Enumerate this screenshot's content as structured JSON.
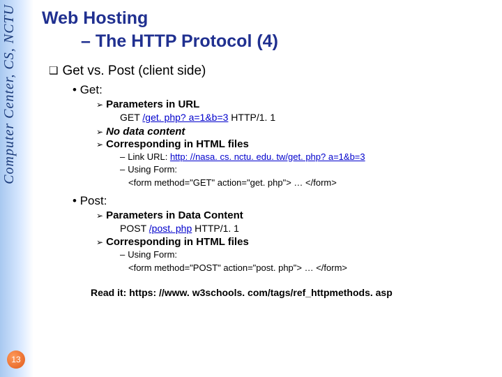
{
  "sidebar": {
    "label": "Computer Center, CS, NCTU",
    "page_number": "13"
  },
  "title": {
    "line1": "Web Hosting",
    "line2": "– The HTTP Protocol (4)"
  },
  "section_header": "Get vs. Post (client side)",
  "get": {
    "label": "Get:",
    "p1": "Parameters in URL",
    "p1_code": "GET /get. php? a=1&b=3 HTTP/1. 1",
    "p1_code_link": "/get. php? a=1&b=3",
    "p2": "No data content",
    "p3": "Corresponding in HTML files",
    "d1_prefix": "Link URL: ",
    "d1_link": "http: //nasa. cs. nctu. edu. tw/get. php? a=1&b=3",
    "d2": "Using Form:",
    "d3": "<form method=\"GET\" action=\"get. php\"> … </form>"
  },
  "post": {
    "label": "Post:",
    "p1": "Parameters in Data Content",
    "p1_code_pre": "POST ",
    "p1_code_link": "/post. php",
    "p1_code_post": " HTTP/1. 1",
    "p2": "Corresponding in HTML files",
    "d1": "Using Form:",
    "d2": "<form method=\"POST\" action=\"post. php\"> … </form>"
  },
  "footer": "Read it: https: //www. w3schools. com/tags/ref_httpmethods. asp"
}
